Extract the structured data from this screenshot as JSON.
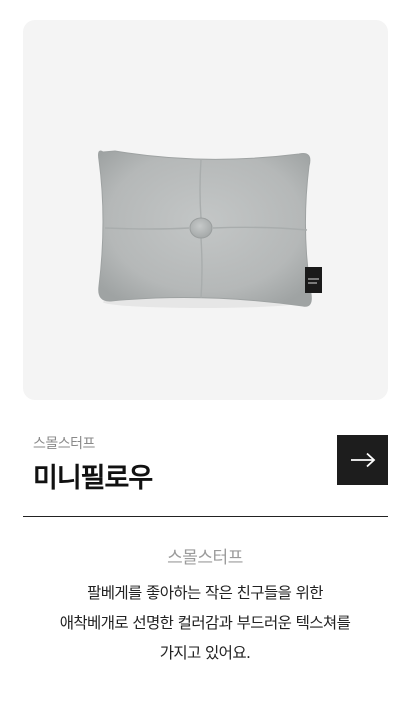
{
  "product": {
    "brand": "스몰스터프",
    "name": "미니필로우",
    "image_icon": "pillow-image",
    "arrow_icon": "arrow-right-icon"
  },
  "description": {
    "brand": "스몰스터프",
    "lines": [
      "팔베게를 좋아하는 작은 친구들을 위한",
      "애착베개로 선명한 컬러감과 부드러운 텍스쳐를",
      "가지고 있어요."
    ]
  },
  "colors": {
    "card_background": "#f4f4f4",
    "pillow": "#b9bcbc",
    "button_background": "#1d1d1d",
    "brand_text": "#8a8a8a"
  }
}
